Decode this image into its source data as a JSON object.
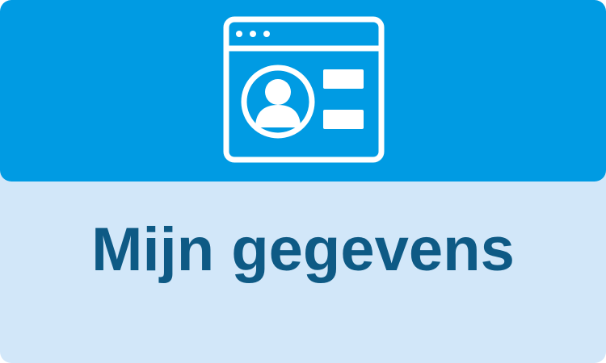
{
  "tile": {
    "label": "Mijn gegevens",
    "icon": "user-profile-window-icon"
  },
  "colors": {
    "header_background": "#009be3",
    "tile_background": "#d2e7f9",
    "label_text": "#0e5a85",
    "icon": "#ffffff"
  }
}
